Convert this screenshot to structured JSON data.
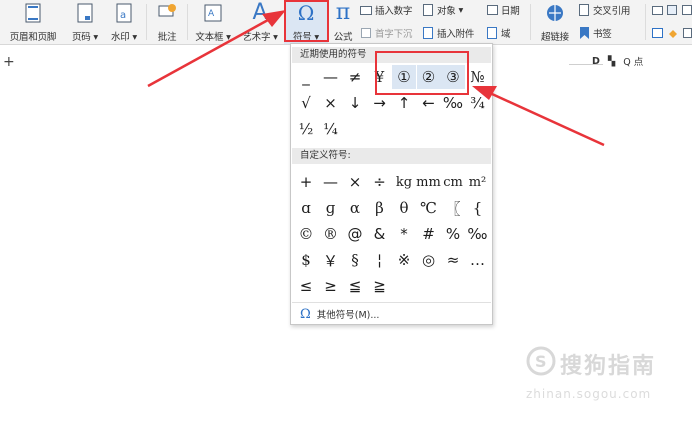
{
  "ribbon": {
    "header_footer": "页眉和页脚",
    "page_number": "页码",
    "watermark": "水印",
    "comment": "批注",
    "textbox": "文本框",
    "art_text": "艺术字",
    "symbol": "符号",
    "formula": "公式",
    "insert_number": "插入数字",
    "object": "对象",
    "date": "日期",
    "drop_cap": "首字下沉",
    "attachment": "插入附件",
    "field": "域",
    "hyperlink": "超链接",
    "cross_ref": "交叉引用",
    "bookmark": "书签",
    "dropdown_arrow": "▾"
  },
  "toolbar_right": {
    "search_label": "Q 点"
  },
  "symbol_panel": {
    "recent_header": "近期使用的符号",
    "recent": [
      [
        "_",
        "—",
        "≠",
        "¥",
        "①",
        "②",
        "③",
        "№"
      ],
      [
        "√",
        "×",
        "↓",
        "→",
        "↑",
        "←",
        "‰",
        "¾"
      ],
      [
        "½",
        "¼"
      ]
    ],
    "custom_header": "自定义符号:",
    "custom": [
      [
        "+",
        "—",
        "×",
        "÷",
        "kg",
        "mm",
        "cm",
        "m²"
      ],
      [
        "ɑ",
        "ɡ",
        "α",
        "β",
        "θ",
        "℃",
        "〖",
        "{"
      ],
      [
        "©",
        "®",
        "@",
        "&",
        "*",
        "#",
        "%",
        "‰"
      ],
      [
        "$",
        "￥",
        "§",
        "¦",
        "※",
        "◎",
        "≈",
        "…"
      ],
      [
        "≤",
        "≥",
        "≦",
        "≧"
      ]
    ],
    "more_label": "其他符号(M)...",
    "more_icon": "Ω"
  },
  "watermark": {
    "text": "搜狗指南",
    "url": "zhinan.sogou.com"
  },
  "colors": {
    "accent": "#2e72c6",
    "annotation": "#e8343a"
  }
}
